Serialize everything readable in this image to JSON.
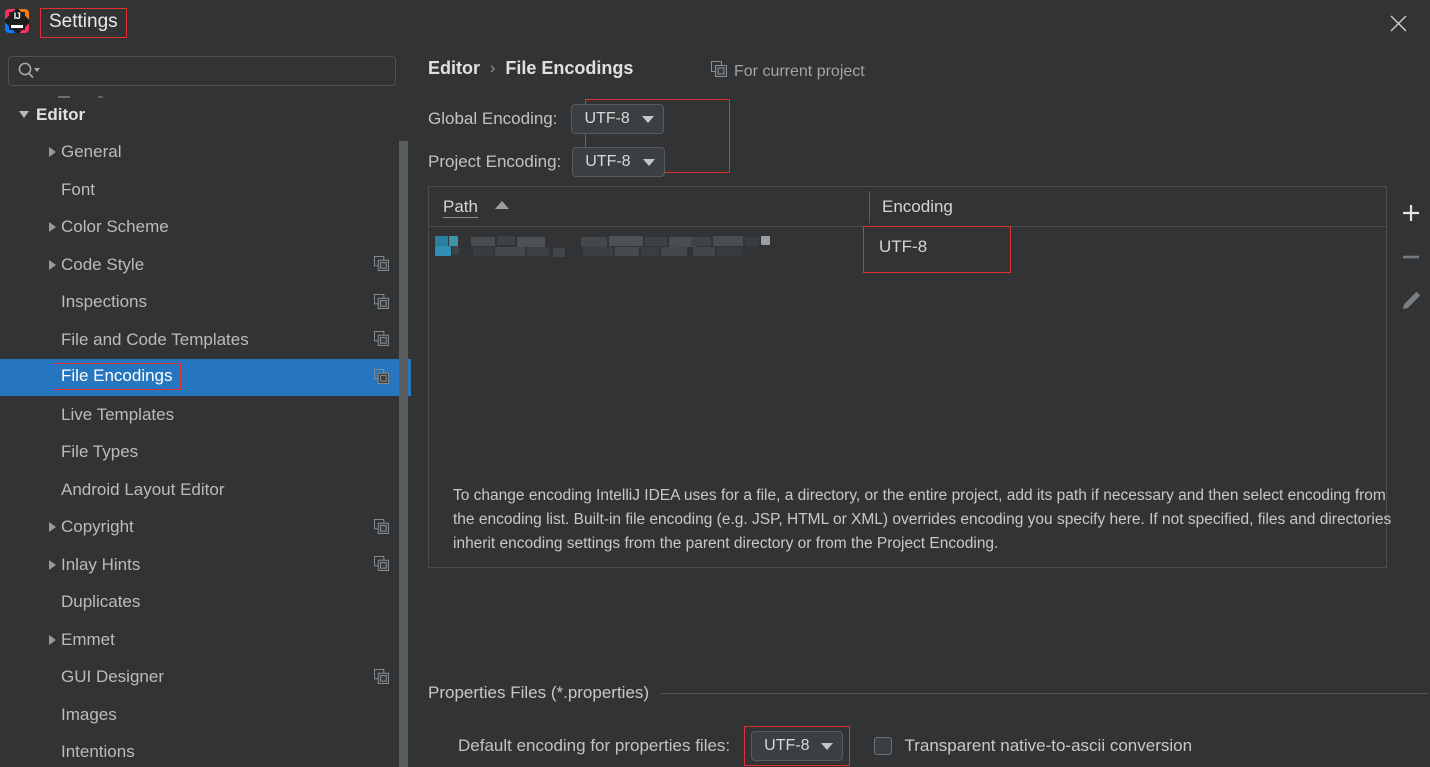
{
  "window": {
    "title": "Settings",
    "logo_icon": "intellij-idea-logo",
    "close_icon": "close-icon"
  },
  "search": {
    "value": "",
    "placeholder": "",
    "icon": "search-icon"
  },
  "sidebar": {
    "items": [
      {
        "label": "Editor",
        "depth": 0,
        "expander": "down",
        "selected": false,
        "project_icon": false
      },
      {
        "label": "General",
        "depth": 1,
        "expander": "right",
        "selected": false,
        "project_icon": false
      },
      {
        "label": "Font",
        "depth": 1,
        "expander": "none",
        "selected": false,
        "project_icon": false
      },
      {
        "label": "Color Scheme",
        "depth": 1,
        "expander": "right",
        "selected": false,
        "project_icon": false
      },
      {
        "label": "Code Style",
        "depth": 1,
        "expander": "right",
        "selected": false,
        "project_icon": true
      },
      {
        "label": "Inspections",
        "depth": 1,
        "expander": "none",
        "selected": false,
        "project_icon": true
      },
      {
        "label": "File and Code Templates",
        "depth": 1,
        "expander": "none",
        "selected": false,
        "project_icon": true
      },
      {
        "label": "File Encodings",
        "depth": 1,
        "expander": "none",
        "selected": true,
        "project_icon": true
      },
      {
        "label": "Live Templates",
        "depth": 1,
        "expander": "none",
        "selected": false,
        "project_icon": false
      },
      {
        "label": "File Types",
        "depth": 1,
        "expander": "none",
        "selected": false,
        "project_icon": false
      },
      {
        "label": "Android Layout Editor",
        "depth": 1,
        "expander": "none",
        "selected": false,
        "project_icon": false
      },
      {
        "label": "Copyright",
        "depth": 1,
        "expander": "right",
        "selected": false,
        "project_icon": true
      },
      {
        "label": "Inlay Hints",
        "depth": 1,
        "expander": "right",
        "selected": false,
        "project_icon": true
      },
      {
        "label": "Duplicates",
        "depth": 1,
        "expander": "none",
        "selected": false,
        "project_icon": false
      },
      {
        "label": "Emmet",
        "depth": 1,
        "expander": "right",
        "selected": false,
        "project_icon": false
      },
      {
        "label": "GUI Designer",
        "depth": 1,
        "expander": "none",
        "selected": false,
        "project_icon": true
      },
      {
        "label": "Images",
        "depth": 1,
        "expander": "none",
        "selected": false,
        "project_icon": false
      },
      {
        "label": "Intentions",
        "depth": 1,
        "expander": "none",
        "selected": false,
        "project_icon": false
      }
    ]
  },
  "header": {
    "breadcrumb_parent": "Editor",
    "breadcrumb_sep": "›",
    "breadcrumb_current": "File Encodings",
    "scope_label": "For current project",
    "scope_icon": "project-scope-icon"
  },
  "encoding": {
    "global_label": "Global Encoding:",
    "global_value": "UTF-8",
    "project_label": "Project Encoding:",
    "project_value": "UTF-8"
  },
  "table": {
    "columns": [
      "Path",
      "Encoding"
    ],
    "sort_column": "Path",
    "sort_direction": "ascending",
    "rows": [
      {
        "path": "",
        "path_redacted": true,
        "encoding": "UTF-8"
      }
    ],
    "toolbar": [
      {
        "name": "add-path-button",
        "icon": "plus-icon",
        "enabled": true
      },
      {
        "name": "remove-path-button",
        "icon": "minus-icon",
        "enabled": false
      },
      {
        "name": "edit-path-button",
        "icon": "pencil-icon",
        "enabled": false
      }
    ]
  },
  "description": "To change encoding IntelliJ IDEA uses for a file, a directory, or the entire project, add its path if necessary and then select encoding from the encoding list. Built-in file encoding (e.g. JSP, HTML or XML) overrides encoding you specify here. If not specified, files and directories inherit encoding settings from the parent directory or from the Project Encoding.",
  "properties_section": {
    "title": "Properties Files (*.properties)",
    "default_encoding_label": "Default encoding for properties files:",
    "default_encoding_value": "UTF-8",
    "transparent_checkbox_label": "Transparent native-to-ascii conversion",
    "transparent_checked": false
  },
  "colors": {
    "background": "#313335",
    "selection_blue": "#2675bf",
    "annotation_red": "#e03030",
    "text": "#bbbbbb"
  }
}
